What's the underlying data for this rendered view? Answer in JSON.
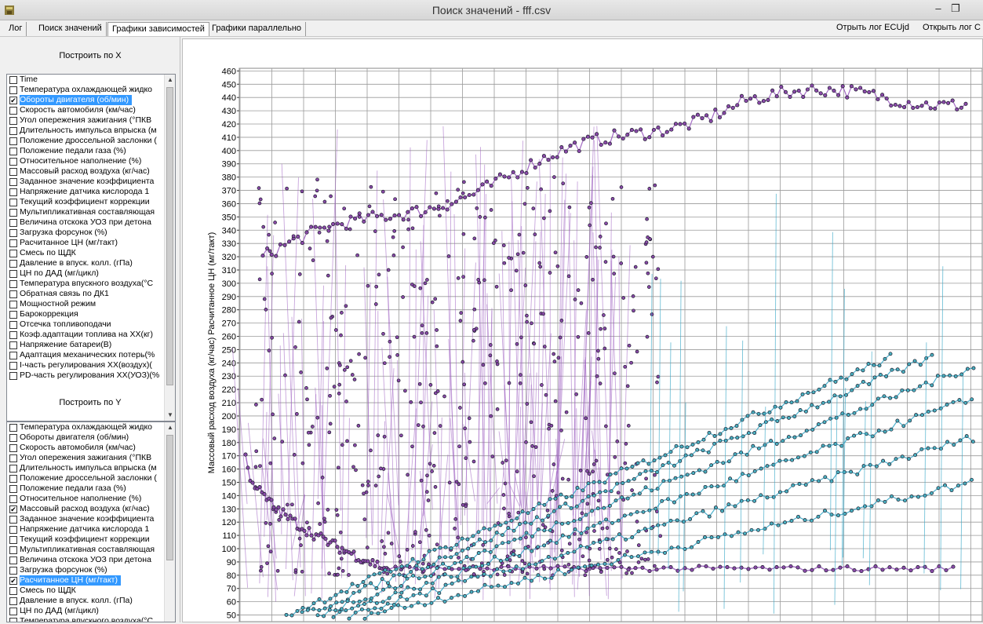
{
  "window": {
    "title": "Поиск значений - fff.csv",
    "minimize_glyph": "–",
    "maximize_glyph": "❐"
  },
  "tabs": [
    "Лог",
    "Поиск значений",
    "Графики зависимостей",
    "Графики параллельно"
  ],
  "active_tab": 2,
  "right_links": [
    "Отрыть лог ECUjd",
    "Открыть лог С"
  ],
  "x_panel": {
    "label": "Построить по X",
    "items": [
      {
        "label": "Time",
        "checked": false,
        "selected": false
      },
      {
        "label": "Температура охлаждающей жидко",
        "checked": false,
        "selected": false
      },
      {
        "label": "Обороты  двигателя (об/мин)",
        "checked": true,
        "selected": true
      },
      {
        "label": "Скорость автомобиля (км/час)",
        "checked": false,
        "selected": false
      },
      {
        "label": "Угол опережения зажигания (°ПКВ",
        "checked": false,
        "selected": false
      },
      {
        "label": "Длительность импульса впрыска (м",
        "checked": false,
        "selected": false
      },
      {
        "label": "Положение дроссельной заслонки (",
        "checked": false,
        "selected": false
      },
      {
        "label": "Положение педали газа (%)",
        "checked": false,
        "selected": false
      },
      {
        "label": "Относительное наполнение (%)",
        "checked": false,
        "selected": false
      },
      {
        "label": "Массовый расход воздуха (кг/час)",
        "checked": false,
        "selected": false
      },
      {
        "label": "Заданное значение коэффициента",
        "checked": false,
        "selected": false
      },
      {
        "label": "Напряжение датчика кислорода 1",
        "checked": false,
        "selected": false
      },
      {
        "label": "Текущий коэффициент коррекции",
        "checked": false,
        "selected": false
      },
      {
        "label": "Мультипликативная составляющая",
        "checked": false,
        "selected": false
      },
      {
        "label": "Величина отскока УОЗ при детона",
        "checked": false,
        "selected": false
      },
      {
        "label": "Загрузка форсунок (%)",
        "checked": false,
        "selected": false
      },
      {
        "label": "Расчитанное ЦН (мг/такт)",
        "checked": false,
        "selected": false
      },
      {
        "label": "Смесь по ЩДК",
        "checked": false,
        "selected": false
      },
      {
        "label": "Давление в впуск. колл. (гПа)",
        "checked": false,
        "selected": false
      },
      {
        "label": "ЦН по ДАД (мг/цикл)",
        "checked": false,
        "selected": false
      },
      {
        "label": "Температура впускного воздуха(°С",
        "checked": false,
        "selected": false
      },
      {
        "label": "Обратная связь по ДК1",
        "checked": false,
        "selected": false
      },
      {
        "label": "Мощностной режим",
        "checked": false,
        "selected": false
      },
      {
        "label": "Барокоррекция",
        "checked": false,
        "selected": false
      },
      {
        "label": "Отсечка топливоподачи",
        "checked": false,
        "selected": false
      },
      {
        "label": "Коэф.адаптации топлива на ХХ(кг)",
        "checked": false,
        "selected": false
      },
      {
        "label": "Напряжение батареи(В)",
        "checked": false,
        "selected": false
      },
      {
        "label": "Адаптация механических потерь(%",
        "checked": false,
        "selected": false
      },
      {
        "label": "I-часть регулирования ХХ(воздух)(",
        "checked": false,
        "selected": false
      },
      {
        "label": "PD-часть регулирования ХХ(УОЗ)(%",
        "checked": false,
        "selected": false
      }
    ]
  },
  "y_panel": {
    "label": "Построить по Y",
    "items": [
      {
        "label": "Температура охлаждающей жидко",
        "checked": false,
        "selected": false
      },
      {
        "label": "Обороты  двигателя (об/мин)",
        "checked": false,
        "selected": false
      },
      {
        "label": "Скорость автомобиля (км/час)",
        "checked": false,
        "selected": false
      },
      {
        "label": "Угол опережения зажигания (°ПКВ",
        "checked": false,
        "selected": false
      },
      {
        "label": "Длительность импульса впрыска (м",
        "checked": false,
        "selected": false
      },
      {
        "label": "Положение дроссельной заслонки (",
        "checked": false,
        "selected": false
      },
      {
        "label": "Положение педали газа (%)",
        "checked": false,
        "selected": false
      },
      {
        "label": "Относительное наполнение (%)",
        "checked": false,
        "selected": false
      },
      {
        "label": "Массовый расход воздуха (кг/час)",
        "checked": true,
        "selected": false
      },
      {
        "label": "Заданное значение коэффициента",
        "checked": false,
        "selected": false
      },
      {
        "label": "Напряжение датчика кислорода 1",
        "checked": false,
        "selected": false
      },
      {
        "label": "Текущий коэффициент коррекции",
        "checked": false,
        "selected": false
      },
      {
        "label": "Мультипликативная составляющая",
        "checked": false,
        "selected": false
      },
      {
        "label": "Величина отскока УОЗ при детона",
        "checked": false,
        "selected": false
      },
      {
        "label": "Загрузка форсунок (%)",
        "checked": false,
        "selected": false
      },
      {
        "label": "Расчитанное ЦН (мг/такт)",
        "checked": true,
        "selected": true
      },
      {
        "label": "Смесь по ЩДК",
        "checked": false,
        "selected": false
      },
      {
        "label": "Давление в впуск. колл. (гПа)",
        "checked": false,
        "selected": false
      },
      {
        "label": "ЦН по ДАД (мг/цикл)",
        "checked": false,
        "selected": false
      },
      {
        "label": "Температура впускного воздуха(°С",
        "checked": false,
        "selected": false
      }
    ]
  },
  "chart_data": {
    "type": "scatter",
    "ylabel": "Массовый расход воздуха (кг/час) Расчитанное ЦН (мг/такт)",
    "y_ticks": [
      460,
      450,
      440,
      430,
      420,
      410,
      400,
      390,
      380,
      370,
      360,
      350,
      340,
      330,
      320,
      310,
      300,
      290,
      280,
      270,
      260,
      250,
      240,
      230,
      220,
      210,
      200,
      190,
      180,
      170,
      160,
      150,
      140,
      130,
      120,
      110,
      100,
      90,
      80,
      70,
      60,
      50
    ],
    "ylim": [
      45,
      462
    ],
    "grid": true,
    "series": [
      {
        "color": "#9a5bbf",
        "marker_fill": "#8a4aa8"
      },
      {
        "color": "#3aa8c8",
        "marker_fill": "#4ab0c0"
      }
    ]
  }
}
